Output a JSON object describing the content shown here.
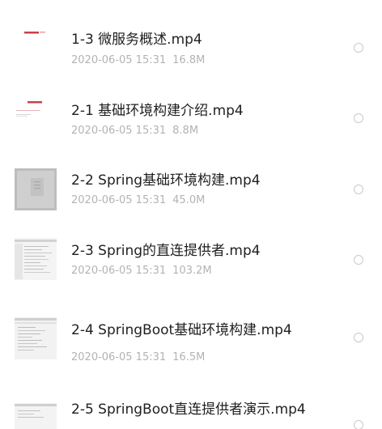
{
  "files": [
    {
      "name": "1-3 微服务概述.mp4",
      "date": "2020-06-05 15:31",
      "size": "16.8M",
      "thumb": "video-thumbnail-title"
    },
    {
      "name": "2-1 基础环境构建介绍.mp4",
      "date": "2020-06-05 15:31",
      "size": "8.8M",
      "thumb": "video-thumbnail-title"
    },
    {
      "name": "2-2 Spring基础环境构建.mp4",
      "date": "2020-06-05 15:31",
      "size": "45.0M",
      "thumb": "video-thumbnail-dialog"
    },
    {
      "name": "2-3 Spring的直连提供者.mp4",
      "date": "2020-06-05 15:31",
      "size": "103.2M",
      "thumb": "video-thumbnail-ide"
    },
    {
      "name": "2-4 SpringBoot基础环境构建.mp4",
      "date": "2020-06-05 15:31",
      "size": "16.5M",
      "thumb": "video-thumbnail-ide"
    },
    {
      "name": "2-5 SpringBoot直连提供者演示.mp4",
      "date": "",
      "size": "",
      "thumb": "video-thumbnail-ide"
    }
  ]
}
